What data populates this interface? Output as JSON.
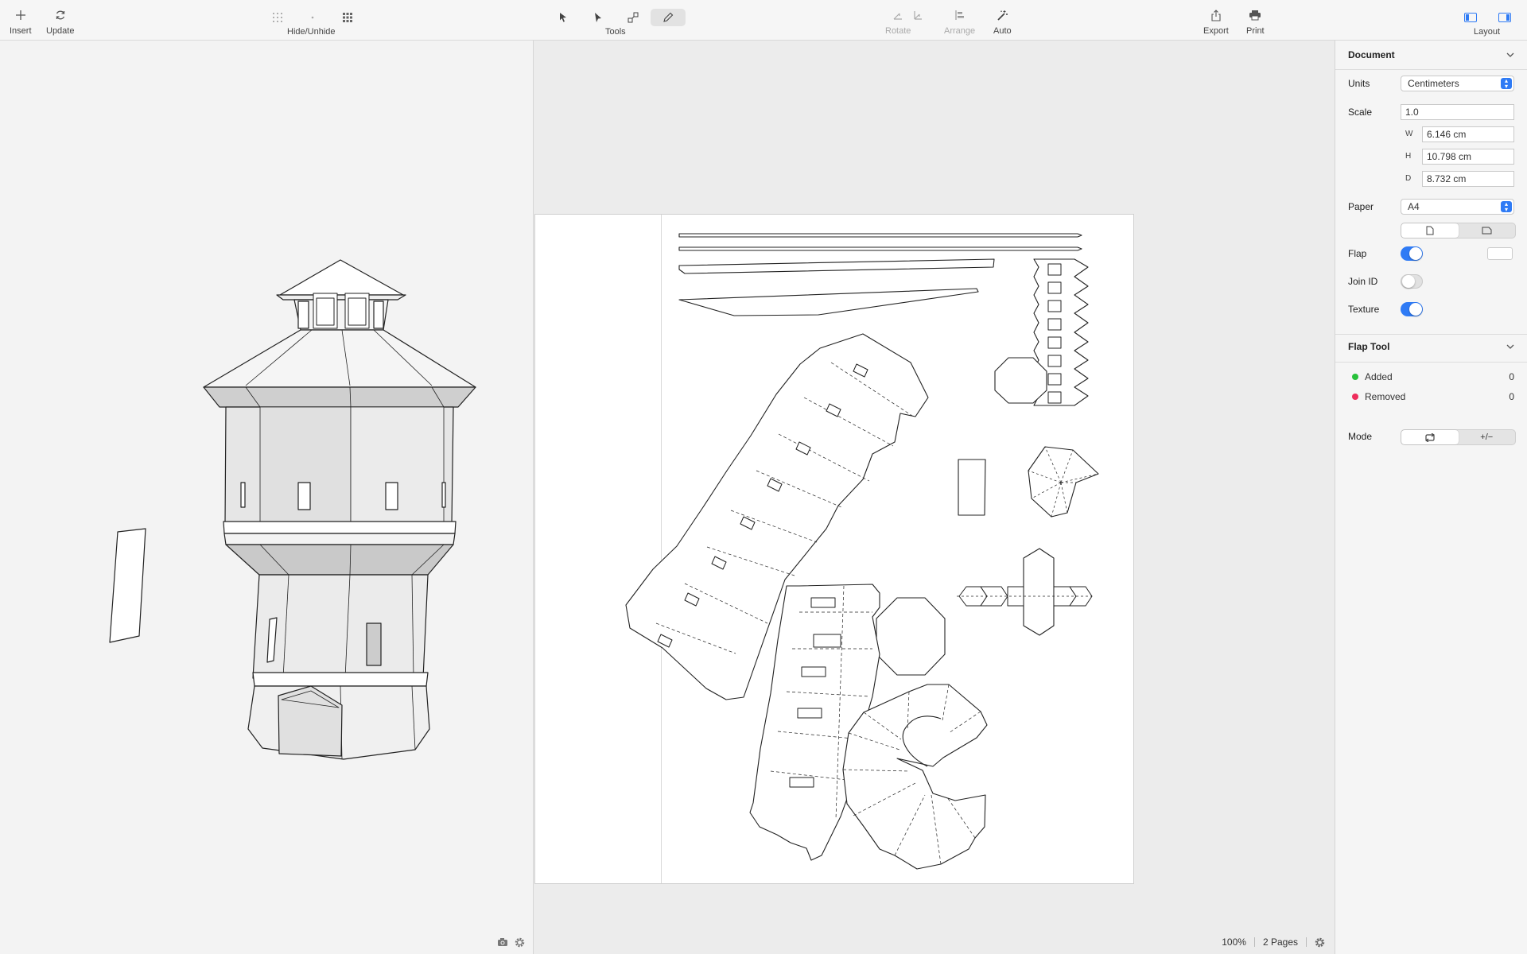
{
  "toolbar": {
    "insert_label": "Insert",
    "update_label": "Update",
    "hide_unhide_label": "Hide/Unhide",
    "tools_label": "Tools",
    "rotate_label": "Rotate",
    "arrange_label": "Arrange",
    "auto_label": "Auto",
    "export_label": "Export",
    "print_label": "Print",
    "layout_label": "Layout"
  },
  "status": {
    "zoom": "100%",
    "pages": "2 Pages"
  },
  "document": {
    "title": "Document",
    "units_label": "Units",
    "units_value": "Centimeters",
    "scale_label": "Scale",
    "scale_value": "1.0",
    "w_label": "W",
    "w_value": "6.146 cm",
    "h_label": "H",
    "h_value": "10.798 cm",
    "d_label": "D",
    "d_value": "8.732 cm",
    "paper_label": "Paper",
    "paper_value": "A4",
    "flap_label": "Flap",
    "flap_on": true,
    "join_id_label": "Join ID",
    "join_id_on": false,
    "texture_label": "Texture",
    "texture_on": true
  },
  "flap_tool": {
    "title": "Flap Tool",
    "added_label": "Added",
    "added_count": "0",
    "removed_label": "Removed",
    "removed_count": "0",
    "mode_label": "Mode",
    "mode_add_remove": "+/−"
  },
  "colors": {
    "accent": "#2f7bf5",
    "added": "#27c13a",
    "removed": "#ee2d5c"
  }
}
